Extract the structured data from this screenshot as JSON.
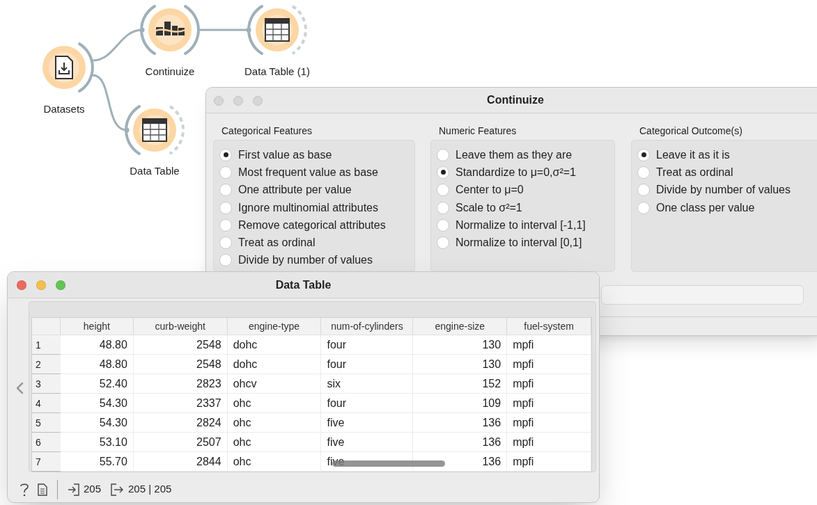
{
  "canvas": {
    "nodes": [
      {
        "label": "Datasets",
        "kind": "file"
      },
      {
        "label": "Continuize",
        "kind": "continuize"
      },
      {
        "label": "Data Table (1)",
        "kind": "table"
      },
      {
        "label": "Data Table",
        "kind": "table"
      }
    ]
  },
  "continuize_window": {
    "title": "Continuize",
    "focused": false,
    "groups": [
      {
        "title": "Categorical Features",
        "options": [
          {
            "label": "First value as base",
            "selected": true
          },
          {
            "label": "Most frequent value as base",
            "selected": false
          },
          {
            "label": "One attribute per value",
            "selected": false
          },
          {
            "label": "Ignore multinomial attributes",
            "selected": false
          },
          {
            "label": "Remove categorical attributes",
            "selected": false
          },
          {
            "label": "Treat as ordinal",
            "selected": false
          },
          {
            "label": "Divide by number of values",
            "selected": false
          }
        ]
      },
      {
        "title": "Numeric Features",
        "options": [
          {
            "label": "Leave them as they are",
            "selected": false
          },
          {
            "label": "Standardize to μ=0,σ²=1",
            "selected": true
          },
          {
            "label": "Center to μ=0",
            "selected": false
          },
          {
            "label": "Scale to σ²=1",
            "selected": false
          },
          {
            "label": "Normalize to interval [-1,1]",
            "selected": false
          },
          {
            "label": "Normalize to interval [0,1]",
            "selected": false
          }
        ]
      },
      {
        "title": "Categorical Outcome(s)",
        "options": [
          {
            "label": "Leave it as it is",
            "selected": true
          },
          {
            "label": "Treat as ordinal",
            "selected": false
          },
          {
            "label": "Divide by number of values",
            "selected": false
          },
          {
            "label": "One class per value",
            "selected": false
          }
        ]
      }
    ]
  },
  "data_table_window": {
    "title": "Data Table",
    "focused": true,
    "columns": [
      {
        "label": "height",
        "kind": "numeric"
      },
      {
        "label": "curb-weight",
        "kind": "numeric"
      },
      {
        "label": "engine-type",
        "kind": "text"
      },
      {
        "label": "num-of-cylinders",
        "kind": "text"
      },
      {
        "label": "engine-size",
        "kind": "numeric"
      },
      {
        "label": "fuel-system",
        "kind": "text"
      }
    ],
    "rows": [
      {
        "index": "1",
        "cells": [
          "48.80",
          "2548",
          "dohc",
          "four",
          "130",
          "mpfi"
        ]
      },
      {
        "index": "2",
        "cells": [
          "48.80",
          "2548",
          "dohc",
          "four",
          "130",
          "mpfi"
        ]
      },
      {
        "index": "3",
        "cells": [
          "52.40",
          "2823",
          "ohcv",
          "six",
          "152",
          "mpfi"
        ]
      },
      {
        "index": "4",
        "cells": [
          "54.30",
          "2337",
          "ohc",
          "four",
          "109",
          "mpfi"
        ]
      },
      {
        "index": "5",
        "cells": [
          "54.30",
          "2824",
          "ohc",
          "five",
          "136",
          "mpfi"
        ]
      },
      {
        "index": "6",
        "cells": [
          "53.10",
          "2507",
          "ohc",
          "five",
          "136",
          "mpfi"
        ]
      },
      {
        "index": "7",
        "cells": [
          "55.70",
          "2844",
          "ohc",
          "five",
          "136",
          "mpfi"
        ]
      }
    ],
    "status_bar": {
      "input_count": "205",
      "output_count": "205 | 205"
    }
  }
}
